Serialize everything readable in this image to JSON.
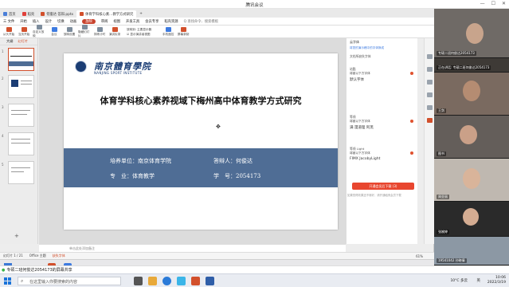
{
  "meeting": {
    "title": "腾讯会议",
    "share_text": "专硕二班何俊达2054173的屏幕共享"
  },
  "wps": {
    "tabs": [
      {
        "label": "首页",
        "color": "#4a7fd8"
      },
      {
        "label": "稻壳",
        "color": "#e0403a"
      },
      {
        "label": "何俊达 答辩.pptx",
        "color": "#d2502c"
      },
      {
        "label": "体育学科核心素…教学方式研究",
        "color": "#d2502c"
      }
    ],
    "menu": [
      "三 文件",
      "开始",
      "插入",
      "设计",
      "切换",
      "动画",
      "放映",
      "审阅",
      "视图",
      "开发工具",
      "会员专享",
      "稻壳资源",
      "Q 查找命令、搜索模板"
    ],
    "menu_active_index": 6,
    "toolbar": [
      {
        "label": "从头开始",
        "color": "#d2502c"
      },
      {
        "label": "当页开始",
        "color": "#d2502c"
      },
      {
        "label": "自定义放映",
        "color": "#7c8c9c"
      },
      {
        "label": "会议",
        "color": "#3e7be0"
      },
      {
        "label": "放映设置",
        "color": "#7c8c9c"
      },
      {
        "label": "隐藏幻灯片",
        "color": "#7c8c9c"
      },
      {
        "label": "排练计时",
        "color": "#7c8c9c"
      },
      {
        "label": "演讲实录",
        "color": "#d2502c"
      }
    ],
    "toolbar_side": [
      "放映到: 主要显示器",
      "显示演讲者视图"
    ],
    "toolbar_right": [
      {
        "label": "手机遥控",
        "color": "#3e7be0"
      },
      {
        "label": "屏幕录制",
        "color": "#d2502c"
      }
    ],
    "left_tabs": [
      "大纲",
      "幻灯片"
    ],
    "slide_numbers": [
      "1",
      "2",
      "3",
      "4",
      "5"
    ],
    "slide": {
      "logo_cn": "南京體育學院",
      "logo_en": "NANJING SPORT INSTITUTE",
      "title": "体育学科核心素养视域下梅州高中体育教学方式研究",
      "unit_label": "培养单位：南京体育学院",
      "answer_label": "答辩人：何俊达",
      "major_label": "专　业：体育教学",
      "id_label": "学　号：2054173"
    },
    "notes_placeholder": "单击此处添加备注",
    "status": {
      "slide_pos": "幻灯片 1 / 21",
      "theme": "Office 主题",
      "font_missing": "缺失字体",
      "zoom": "61%"
    },
    "right_panel": {
      "header": "云字体",
      "link": "将您的演示稿中的字体换成",
      "section": "文档所缺失字体",
      "fonts": [
        {
          "name": "站酷",
          "note": "将被以下方字体",
          "value": "默认字体"
        },
        {
          "name": "等线",
          "note": "将被以下方字体",
          "value": "满 漫道理 阿黑"
        },
        {
          "name": "等线 Light",
          "note": "将被以下方字体",
          "value": "FIMX JacobyLight"
        }
      ],
      "button": "开通会员后下载 (3)",
      "footnote": "如果觉得效果还不够好，请开通稻壳会员下载"
    }
  },
  "participants": [
    {
      "label": "专硕二班何俊达2054173",
      "bg": "#6f6a66"
    },
    {
      "label": "正在讲话: 专硕二班何俊达2054173",
      "bg": "#3e3a36"
    },
    {
      "label": "王剑",
      "bg": "#7a6a60"
    },
    {
      "label": "图书",
      "bg": "#645e5a"
    },
    {
      "label": "周亚丽",
      "bg": "#bfb8b0"
    },
    {
      "label": "张婉婷",
      "bg": "#2a2a2a"
    },
    {
      "label": "19541042 孙晓倩",
      "bg": "#8c98a4"
    }
  ],
  "taskbar": {
    "search_placeholder": "在这里输入你要搜索的内容",
    "weather": "10°C 多云",
    "input": "英",
    "time": "10:06",
    "date": "2022/3/19"
  }
}
